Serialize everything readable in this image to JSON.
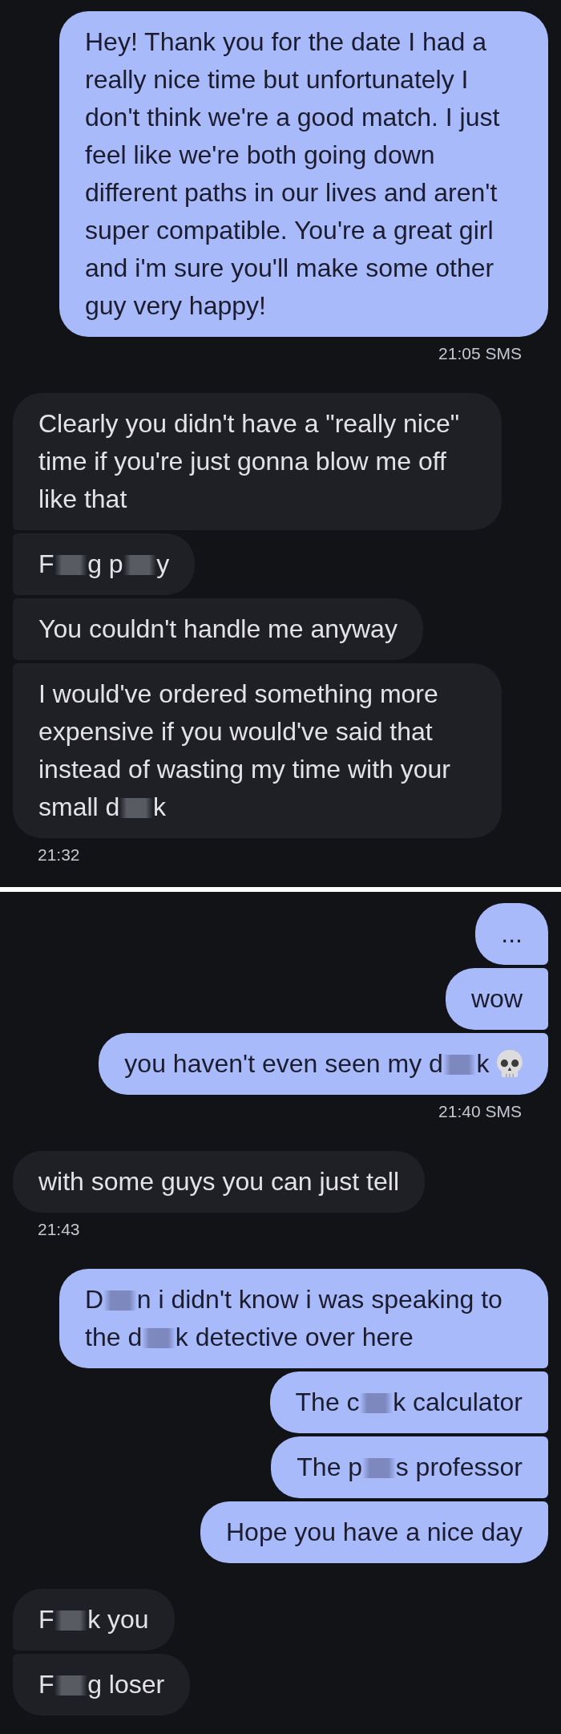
{
  "screenshots": [
    {
      "entries": [
        {
          "kind": "message",
          "sent": true,
          "parts": [
            {
              "kind": "text",
              "text": "Hey! Thank you for the date I had a really nice time but unfortunately I don't think we're a good match. I just feel like we're both going down different paths in our lives and aren't super compatible. You're a great girl and i'm sure you'll make some other guy very happy!"
            }
          ]
        },
        {
          "kind": "timestamp",
          "sent": true,
          "text": "21:05 SMS"
        },
        {
          "kind": "message",
          "sent": false,
          "parts": [
            {
              "kind": "text",
              "text": "Clearly you didn't have a \"really nice\" time if you're just gonna blow me off like that"
            }
          ]
        },
        {
          "kind": "message",
          "sent": false,
          "parts": [
            {
              "kind": "text",
              "text": "F"
            },
            {
              "kind": "redaction"
            },
            {
              "kind": "text",
              "text": "g p"
            },
            {
              "kind": "redaction"
            },
            {
              "kind": "text",
              "text": "y"
            }
          ]
        },
        {
          "kind": "message",
          "sent": false,
          "parts": [
            {
              "kind": "text",
              "text": "You couldn't handle me anyway"
            }
          ]
        },
        {
          "kind": "message",
          "sent": false,
          "parts": [
            {
              "kind": "text",
              "text": "I would've ordered something more expensive if you would've said that instead of wasting my time with your small d"
            },
            {
              "kind": "redaction"
            },
            {
              "kind": "text",
              "text": "k"
            }
          ]
        },
        {
          "kind": "timestamp",
          "sent": false,
          "text": "21:32"
        }
      ]
    },
    {
      "entries": [
        {
          "kind": "message",
          "sent": true,
          "parts": [
            {
              "kind": "text",
              "text": "..."
            }
          ]
        },
        {
          "kind": "message",
          "sent": true,
          "parts": [
            {
              "kind": "text",
              "text": "wow"
            }
          ]
        },
        {
          "kind": "message",
          "sent": true,
          "parts": [
            {
              "kind": "text",
              "text": "you haven't even seen my d"
            },
            {
              "kind": "redaction"
            },
            {
              "kind": "text",
              "text": "k"
            },
            {
              "kind": "emoji"
            }
          ]
        },
        {
          "kind": "timestamp",
          "sent": true,
          "text": "21:40 SMS"
        },
        {
          "kind": "message",
          "sent": false,
          "parts": [
            {
              "kind": "text",
              "text": "with some guys you can just tell"
            }
          ]
        },
        {
          "kind": "timestamp",
          "sent": false,
          "text": "21:43"
        },
        {
          "kind": "message",
          "sent": true,
          "parts": [
            {
              "kind": "text",
              "text": "D"
            },
            {
              "kind": "redaction"
            },
            {
              "kind": "text",
              "text": "n i didn't know i was speaking to the d"
            },
            {
              "kind": "redaction"
            },
            {
              "kind": "text",
              "text": "k detective over here"
            }
          ]
        },
        {
          "kind": "message",
          "sent": true,
          "parts": [
            {
              "kind": "text",
              "text": "The c"
            },
            {
              "kind": "redaction"
            },
            {
              "kind": "text",
              "text": "k calculator"
            }
          ]
        },
        {
          "kind": "message",
          "sent": true,
          "parts": [
            {
              "kind": "text",
              "text": "The p"
            },
            {
              "kind": "redaction"
            },
            {
              "kind": "text",
              "text": "s professor"
            }
          ]
        },
        {
          "kind": "message",
          "sent": true,
          "parts": [
            {
              "kind": "text",
              "text": "Hope you have a nice day"
            }
          ]
        },
        {
          "kind": "message",
          "sent": false,
          "parts": [
            {
              "kind": "text",
              "text": "F"
            },
            {
              "kind": "redaction"
            },
            {
              "kind": "text",
              "text": "k you"
            }
          ]
        },
        {
          "kind": "message",
          "sent": false,
          "parts": [
            {
              "kind": "text",
              "text": "F"
            },
            {
              "kind": "redaction"
            },
            {
              "kind": "text",
              "text": "g loser"
            }
          ]
        }
      ]
    }
  ]
}
